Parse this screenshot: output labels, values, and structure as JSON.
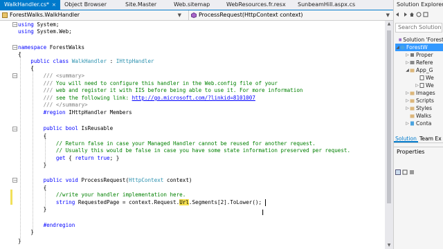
{
  "tabs": [
    {
      "label": "WalkHandler.cs*",
      "active": true,
      "close": "×"
    },
    {
      "label": "Object Browser",
      "active": false
    },
    {
      "label": "Site.Master",
      "active": false
    },
    {
      "label": "Web.sitemap",
      "active": false
    },
    {
      "label": "WebResources.fr.resx",
      "active": false
    },
    {
      "label": "SunbeamHill.aspx.cs",
      "active": false
    }
  ],
  "navbar": {
    "class_path": "ForestWalks.WalkHandler",
    "member": "ProcessRequest(HttpContext context)",
    "dropdown_icon": "chevron-down-icon"
  },
  "code": {
    "line_using1": [
      "using",
      " System;"
    ],
    "line_using2": [
      "using",
      " System.Web;"
    ],
    "line_ns": [
      "namespace",
      " ForestWalks"
    ],
    "brace": "{",
    "brace_close": "}",
    "line_class": [
      "public",
      " ",
      "class",
      " ",
      "WalkHandler",
      " : ",
      "IHttpHandler"
    ],
    "doc1": [
      "/// ",
      "<summary>"
    ],
    "doc2": [
      "///",
      " You will need to configure this handler in the Web.config file of your"
    ],
    "doc3": [
      "///",
      " web and register it with IIS before being able to use it. For more information"
    ],
    "doc4": [
      "///",
      " see the following link: ",
      "http://go.microsoft.com/?linkid=8101007"
    ],
    "doc5": [
      "/// ",
      "</summary>"
    ],
    "region": [
      "#region",
      " IHttpHandler Members"
    ],
    "isreusable": [
      "public",
      " ",
      "bool",
      " IsReusable"
    ],
    "cm1": "// Return false in case your Managed Handler cannot be reused for another request.",
    "cm2": "// Usually this would be false in case you have some state information preserved per request.",
    "get": [
      "get",
      " { ",
      "return",
      " ",
      "true",
      "; }"
    ],
    "process": [
      "public",
      " ",
      "void",
      " ProcessRequest(",
      "HttpContext",
      " context)"
    ],
    "cm3": "//write your handler implementation here.",
    "stmt": [
      "string",
      " RequestedPage = context.Request.",
      "Url",
      ".Segments[2].ToLower();"
    ],
    "endregion": "#endregion"
  },
  "solution_explorer": {
    "title": "Solution Explorer",
    "search_placeholder": "Search Solution Explorer",
    "items": [
      {
        "label": "Solution 'Forest",
        "icon": "solution-icon"
      },
      {
        "label": "ForestW",
        "icon": "web-project-icon",
        "selected": true
      },
      {
        "label": "Proper",
        "icon": "wrench-icon"
      },
      {
        "label": "Refere",
        "icon": "references-icon"
      },
      {
        "label": "App_G",
        "icon": "folder-icon"
      },
      {
        "label": "We",
        "icon": "resx-file-icon"
      },
      {
        "label": "We",
        "icon": "resx-file-icon"
      },
      {
        "label": "Images",
        "icon": "folder-icon"
      },
      {
        "label": "Scripts",
        "icon": "folder-icon"
      },
      {
        "label": "Styles",
        "icon": "folder-icon"
      },
      {
        "label": "Walks",
        "icon": "folder-icon"
      },
      {
        "label": "Conta",
        "icon": "aspx-file-icon"
      }
    ],
    "bottom_tabs": [
      {
        "label": "Solution",
        "active": true
      },
      {
        "label": "Team Ex",
        "active": false
      }
    ]
  },
  "properties": {
    "title": "Properties"
  },
  "colors": {
    "accent": "#007acc",
    "keyword": "#0000ff",
    "type": "#2b91af",
    "comment": "#008000",
    "highlight": "#f5e050",
    "selection": "#3399ff"
  }
}
